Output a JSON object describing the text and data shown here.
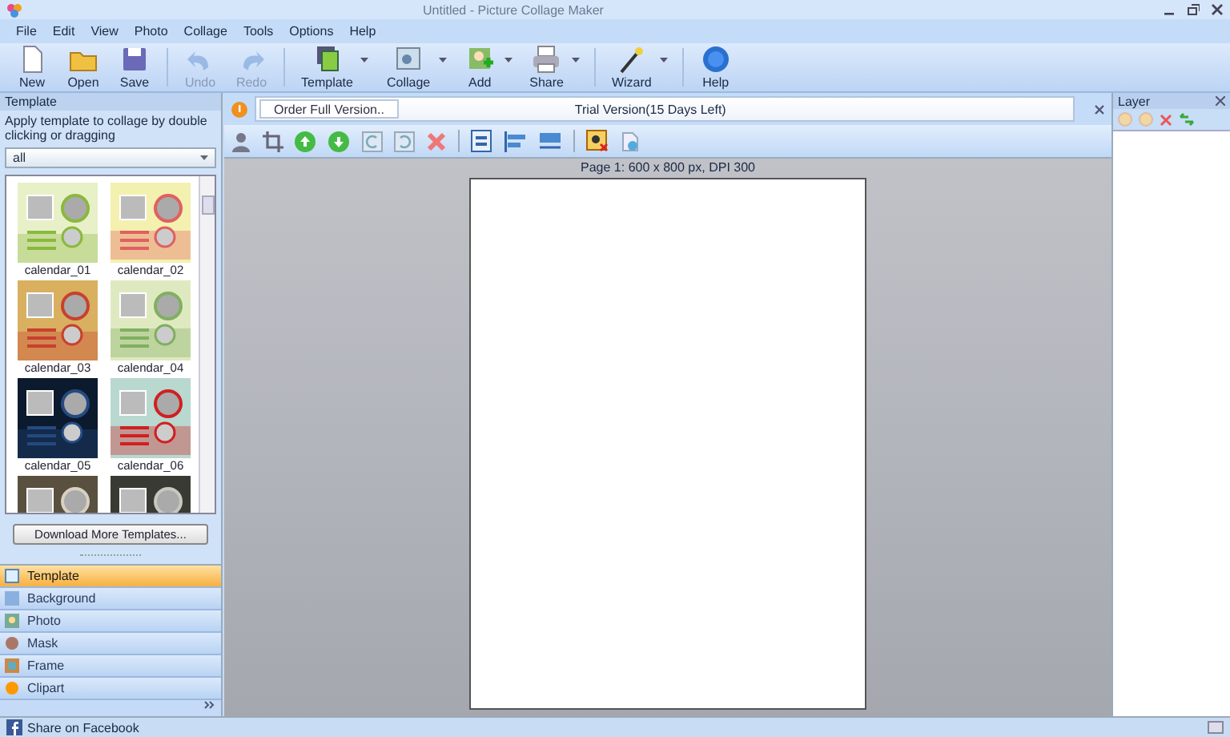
{
  "window": {
    "title": "Untitled - Picture Collage Maker"
  },
  "menu": [
    "File",
    "Edit",
    "View",
    "Photo",
    "Collage",
    "Tools",
    "Options",
    "Help"
  ],
  "toolbar": {
    "groups": [
      [
        {
          "label": "New",
          "disabled": false,
          "dropdown": false
        },
        {
          "label": "Open",
          "disabled": false,
          "dropdown": false
        },
        {
          "label": "Save",
          "disabled": false,
          "dropdown": false
        }
      ],
      [
        {
          "label": "Undo",
          "disabled": true,
          "dropdown": false
        },
        {
          "label": "Redo",
          "disabled": true,
          "dropdown": false
        }
      ],
      [
        {
          "label": "Template",
          "disabled": false,
          "dropdown": true
        },
        {
          "label": "Collage",
          "disabled": false,
          "dropdown": true
        },
        {
          "label": "Add",
          "disabled": false,
          "dropdown": true
        },
        {
          "label": "Share",
          "disabled": false,
          "dropdown": true
        }
      ],
      [
        {
          "label": "Wizard",
          "disabled": false,
          "dropdown": true
        }
      ],
      [
        {
          "label": "Help",
          "disabled": false,
          "dropdown": false
        }
      ]
    ]
  },
  "template_panel": {
    "title": "Template",
    "description": "Apply template to collage by double clicking or dragging",
    "filter": "all",
    "templates": [
      {
        "label": "calendar_01"
      },
      {
        "label": "calendar_02"
      },
      {
        "label": "calendar_03"
      },
      {
        "label": "calendar_04"
      },
      {
        "label": "calendar_05"
      },
      {
        "label": "calendar_06"
      }
    ],
    "download_button": "Download More Templates..."
  },
  "nav": [
    {
      "label": "Template",
      "selected": true
    },
    {
      "label": "Background",
      "selected": false
    },
    {
      "label": "Photo",
      "selected": false
    },
    {
      "label": "Mask",
      "selected": false
    },
    {
      "label": "Frame",
      "selected": false
    },
    {
      "label": "Clipart",
      "selected": false
    }
  ],
  "info_bar": {
    "button": "Order Full Version..",
    "message": "Trial Version(15 Days Left)"
  },
  "canvas": {
    "page_label": "Page 1: 600 x 800 px, DPI 300"
  },
  "layer_panel": {
    "title": "Layer"
  },
  "status_bar": {
    "text": "Share on Facebook"
  }
}
